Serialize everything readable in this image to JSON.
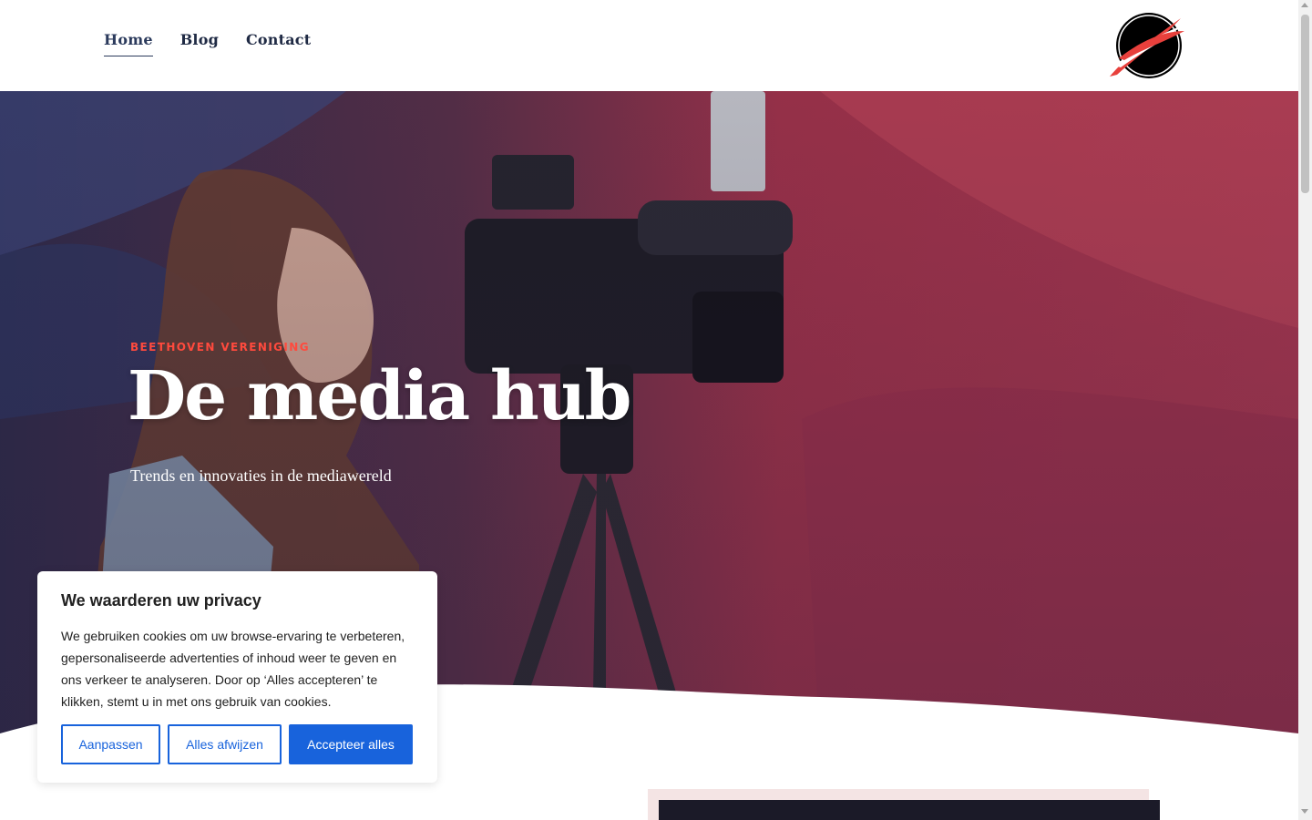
{
  "nav": {
    "items": [
      {
        "label": "Home",
        "active": true
      },
      {
        "label": "Blog",
        "active": false
      },
      {
        "label": "Contact",
        "active": false
      }
    ]
  },
  "logo": {
    "icon": "brand-logo-icon",
    "colors": [
      "#000000",
      "#e8403c"
    ]
  },
  "hero": {
    "eyebrow": "BEETHOVEN VERENIGING",
    "title": "De media hub",
    "subtitle": "Trends en innovaties in de mediawereld",
    "accent_color": "#ff4a3d"
  },
  "cookie": {
    "title": "We waarderen uw privacy",
    "body": "We gebruiken cookies om uw browse-ervaring te verbeteren, gepersonaliseerde advertenties of inhoud weer te geven en ons verkeer te analyseren. Door op ‘Alles accepteren’ te klikken, stemt u in met ons gebruik van cookies.",
    "btn_customize": "Aanpassen",
    "btn_reject": "Alles afwijzen",
    "btn_accept": "Accepteer alles",
    "button_color": "#1863dc"
  }
}
